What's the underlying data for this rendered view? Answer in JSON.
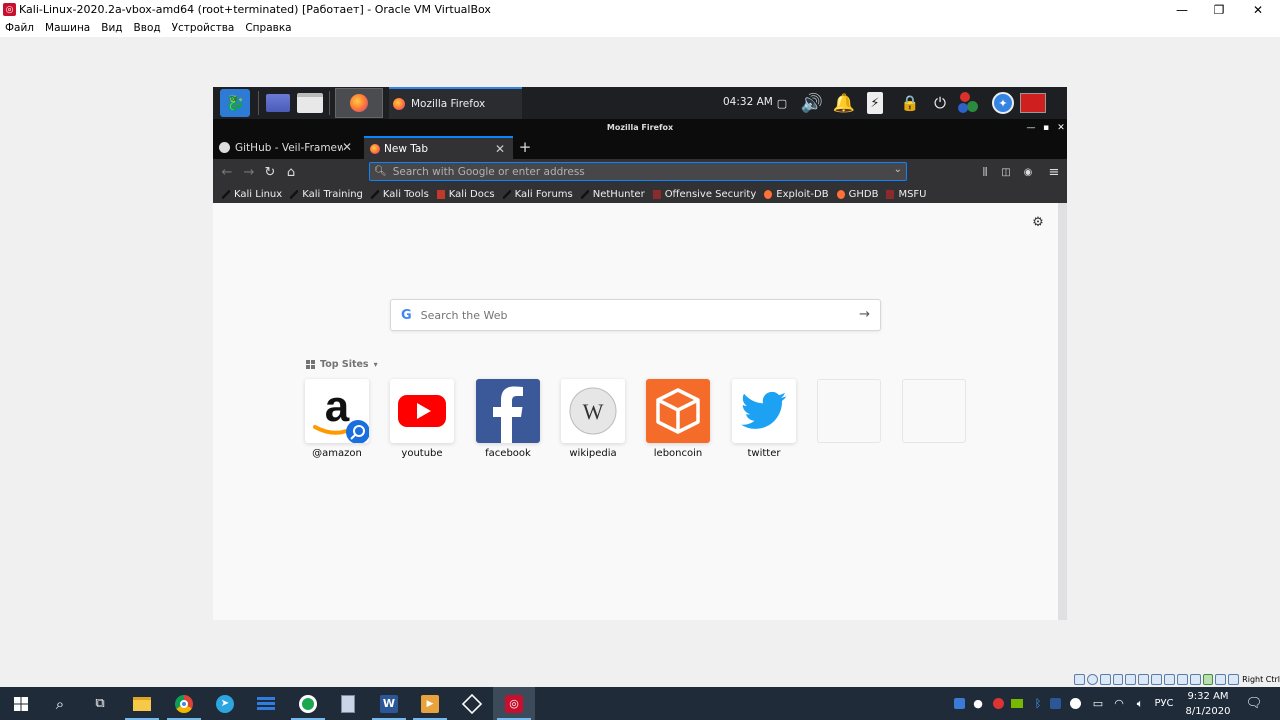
{
  "host": {
    "title": "Kali-Linux-2020.2a-vbox-amd64 (root+terminated) [Работает] - Oracle VM VirtualBox",
    "menu": [
      "Файл",
      "Машина",
      "Вид",
      "Ввод",
      "Устройства",
      "Справка"
    ],
    "window_controls": {
      "minimize": "—",
      "maximize": "❐",
      "close": "✕"
    },
    "host_key": "Right Ctrl"
  },
  "kali_panel": {
    "task_window_title": "Mozilla Firefox",
    "clock": "04:32 AM"
  },
  "firefox": {
    "window_title": "Mozilla Firefox",
    "tabs": [
      {
        "label": "GitHub - Veil-Framewor",
        "active": false
      },
      {
        "label": "New Tab",
        "active": true
      }
    ],
    "new_tab_symbol": "+",
    "url_placeholder": "Search with Google or enter address",
    "bookmarks": [
      {
        "label": "Kali Linux",
        "icon": "dragon-icon"
      },
      {
        "label": "Kali Training",
        "icon": "dragon-icon"
      },
      {
        "label": "Kali Tools",
        "icon": "dragon-icon"
      },
      {
        "label": "Kali Docs",
        "icon": "kali-docs-icon"
      },
      {
        "label": "Kali Forums",
        "icon": "dragon-icon"
      },
      {
        "label": "NetHunter",
        "icon": "dragon-icon"
      },
      {
        "label": "Offensive Security",
        "icon": "offsec-icon"
      },
      {
        "label": "Exploit-DB",
        "icon": "exploit-icon"
      },
      {
        "label": "GHDB",
        "icon": "exploit-icon"
      },
      {
        "label": "MSFU",
        "icon": "offsec-icon"
      }
    ],
    "newtab": {
      "search_placeholder": "Search the Web",
      "top_sites_label": "Top Sites",
      "top_sites": [
        {
          "name": "@amazon",
          "icon": "amazon-icon"
        },
        {
          "name": "youtube",
          "icon": "youtube-icon"
        },
        {
          "name": "facebook",
          "icon": "facebook-icon"
        },
        {
          "name": "wikipedia",
          "icon": "wikipedia-icon"
        },
        {
          "name": "leboncoin",
          "icon": "leboncoin-icon"
        },
        {
          "name": "twitter",
          "icon": "twitter-icon"
        }
      ]
    }
  },
  "taskbar": {
    "language": "РУС",
    "time": "9:32 AM",
    "date": "8/1/2020"
  },
  "colors": {
    "accent": "#0a84ff",
    "kali_blue": "#2d7bd4",
    "taskbar": "#1f2b39"
  }
}
